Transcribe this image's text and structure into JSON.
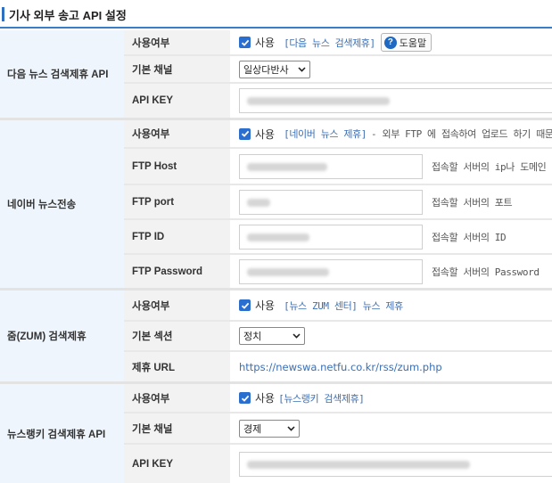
{
  "page": {
    "title": "기사 외부 송고 API 설정"
  },
  "icons": {
    "bullet": "title-bullet-icon",
    "check": "check-icon",
    "help": "question-circle-icon",
    "dropdown": "chevron-down-icon"
  },
  "colors": {
    "accent": "#2a6fd0",
    "link": "#3a6fb5",
    "section_bg": "#eef5fc",
    "label_bg": "#f2f2f2"
  },
  "daum": {
    "section_label": "다음 뉴스 검색제휴 API",
    "use": {
      "label": "사용여부",
      "checkbox_label": "사용",
      "checked": true,
      "link": "[다음 뉴스 검색제휴]",
      "help_button": "도움말"
    },
    "channel": {
      "label": "기본 채널",
      "value": "일상다반사"
    },
    "api_key": {
      "label": "API KEY"
    }
  },
  "naver": {
    "section_label": "네이버 뉴스전송",
    "use": {
      "label": "사용여부",
      "checkbox_label": "사용",
      "checked": true,
      "link": "[네이버 뉴스 제휴]",
      "note": "- 외부 FTP 에 접속하여 업로드 하기 때문"
    },
    "ftp_host": {
      "label": "FTP Host",
      "hint": "접속할 서버의 ip나 도메인"
    },
    "ftp_port": {
      "label": "FTP port",
      "hint": "접속할 서버의 포트"
    },
    "ftp_id": {
      "label": "FTP ID",
      "hint": "접속할 서버의 ID"
    },
    "ftp_password": {
      "label": "FTP Password",
      "hint": "접속할 서버의 Password"
    }
  },
  "zum": {
    "section_label": "줌(ZUM) 검색제휴",
    "use": {
      "label": "사용여부",
      "checkbox_label": "사용",
      "checked": true,
      "link": "[뉴스 ZUM 센터] 뉴스 제휴"
    },
    "section_select": {
      "label": "기본 섹션",
      "value": "정치"
    },
    "url": {
      "label": "제휴 URL",
      "value": "https://newswa.netfu.co.kr/rss/zum.php"
    }
  },
  "newsranky": {
    "section_label": "뉴스랭키 검색제휴 API",
    "use": {
      "label": "사용여부",
      "checkbox_label": "사용",
      "checked": true,
      "link": "[뉴스랭키 검색제휴]"
    },
    "channel": {
      "label": "기본 채널",
      "value": "경제"
    },
    "api_key": {
      "label": "API KEY"
    }
  }
}
